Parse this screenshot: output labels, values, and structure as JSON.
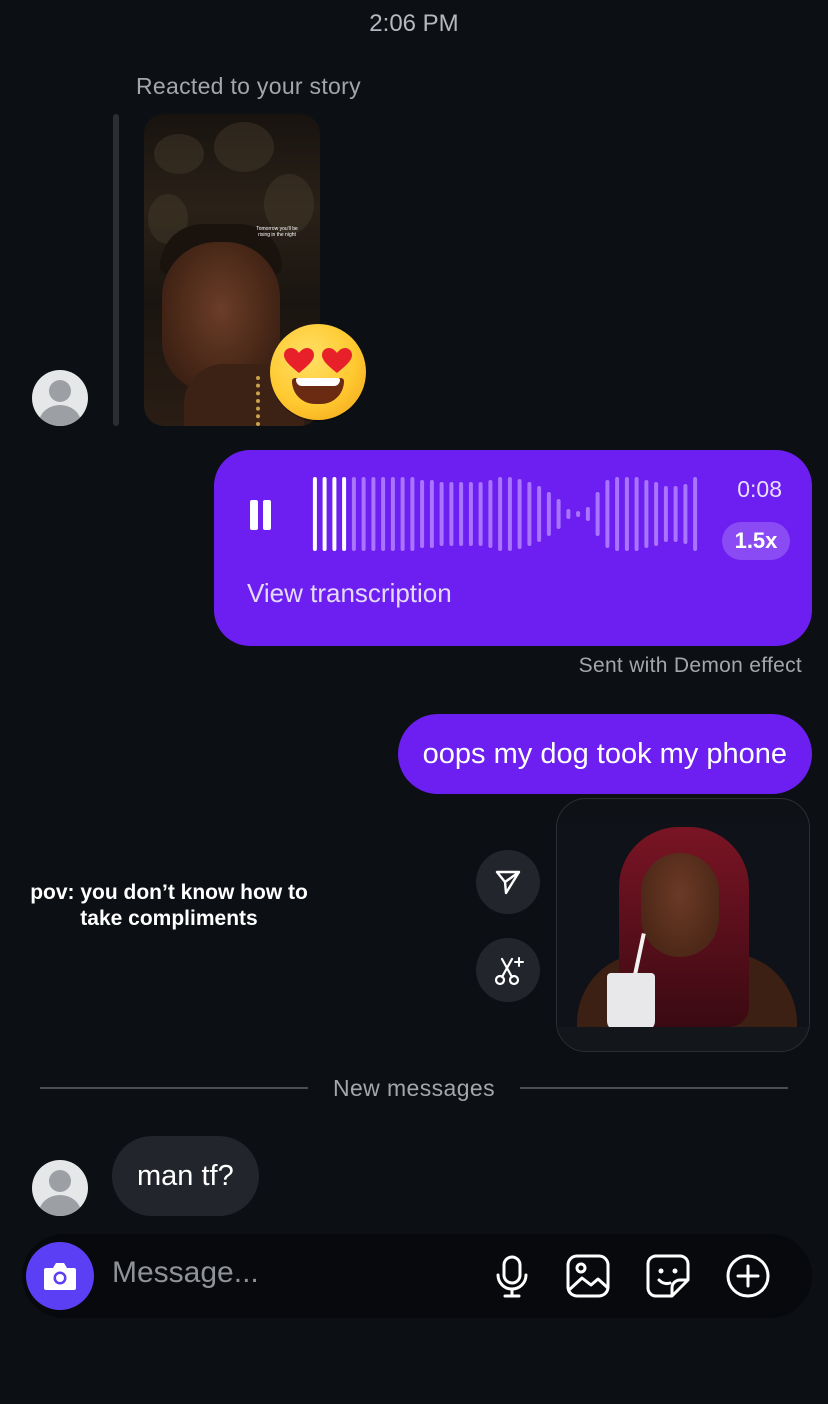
{
  "status": {
    "time": "2:06 PM"
  },
  "story_reply": {
    "label": "Reacted to your story",
    "story_caption_lines": [
      "Tomorrow you'll be",
      "rising in the night"
    ],
    "reaction": "😍"
  },
  "voice_message": {
    "duration": "0:08",
    "speed": "1.5x",
    "transcription_link": "View transcription",
    "played_fraction": 0.1,
    "effect_note": "Sent with Demon effect"
  },
  "messages": [
    {
      "direction": "outgoing",
      "text": "oops my dog took my phone"
    },
    {
      "direction": "incoming",
      "text": "man tf?"
    }
  ],
  "shared_gif": {
    "caption": "pov: you don’t know how to take compliments",
    "actions": [
      "share-icon",
      "remix-icon"
    ]
  },
  "divider": {
    "label": "New messages"
  },
  "composer": {
    "placeholder": "Message...",
    "tools": [
      "microphone-icon",
      "gallery-icon",
      "sticker-icon",
      "add-icon"
    ]
  },
  "colors": {
    "background": "#0c0f14",
    "outgoing_bubble": "#6c1ff0",
    "incoming_bubble": "#22252b",
    "camera_button": "#5b3ff4"
  }
}
